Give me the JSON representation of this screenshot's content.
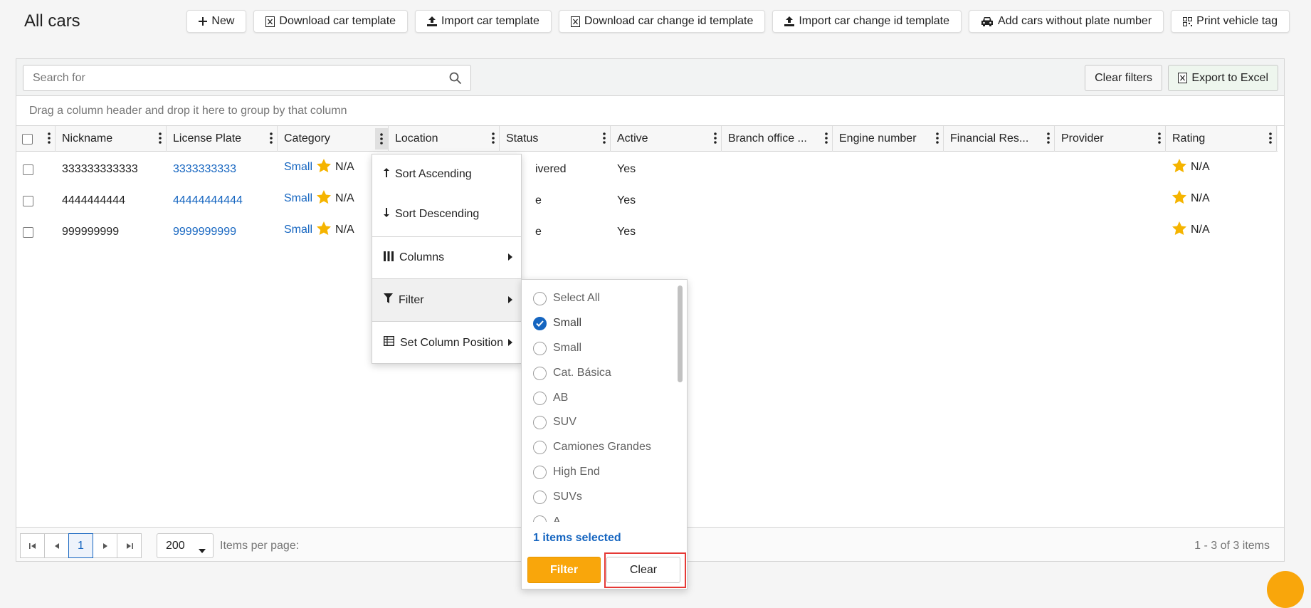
{
  "page": {
    "title": "All cars"
  },
  "toolbar": {
    "new": "New",
    "download_template": "Download car template",
    "import_template": "Import car template",
    "download_change_id": "Download car change id template",
    "import_change_id": "Import car change id template",
    "add_without_plate": "Add cars without plate number",
    "print_tag": "Print vehicle tag"
  },
  "grid_toolbar": {
    "search_placeholder": "Search for",
    "clear_filters": "Clear filters",
    "export_excel": "Export to Excel"
  },
  "group_hint": "Drag a column header and drop it here to group by that column",
  "columns": {
    "nickname": "Nickname",
    "license_plate": "License Plate",
    "category": "Category",
    "location": "Location",
    "status": "Status",
    "active": "Active",
    "branch_office": "Branch office ...",
    "engine_number": "Engine number",
    "financial": "Financial Res...",
    "provider": "Provider",
    "rating": "Rating"
  },
  "rows": [
    {
      "nickname": "333333333333",
      "plate": "3333333333",
      "category": "Small",
      "category_rating": "N/A",
      "status": "ivered",
      "active": "Yes",
      "rating": "N/A"
    },
    {
      "nickname": "4444444444",
      "plate": "44444444444",
      "category": "Small",
      "category_rating": "N/A",
      "status": "e",
      "active": "Yes",
      "rating": "N/A"
    },
    {
      "nickname": "999999999",
      "plate": "9999999999",
      "category": "Small",
      "category_rating": "N/A",
      "status": "e",
      "active": "Yes",
      "rating": "N/A"
    }
  ],
  "column_menu": {
    "sort_asc": "Sort Ascending",
    "sort_desc": "Sort Descending",
    "columns": "Columns",
    "filter": "Filter",
    "set_position": "Set Column Position"
  },
  "filter_popup": {
    "options": [
      {
        "label": "Select All",
        "checked": false
      },
      {
        "label": "Small",
        "checked": true
      },
      {
        "label": "Small",
        "checked": false
      },
      {
        "label": "Cat. Básica",
        "checked": false
      },
      {
        "label": "AB",
        "checked": false
      },
      {
        "label": "SUV",
        "checked": false
      },
      {
        "label": "Camiones Grandes",
        "checked": false
      },
      {
        "label": "High End",
        "checked": false
      },
      {
        "label": "SUVs",
        "checked": false
      },
      {
        "label": "A",
        "checked": false
      }
    ],
    "selected_count": "1 items selected",
    "filter_button": "Filter",
    "clear_button": "Clear"
  },
  "pager": {
    "current_page": "1",
    "page_size": "200",
    "items_per_page_label": "Items per page:",
    "range": "1 - 3 of 3 items"
  },
  "colors": {
    "accent_orange": "#f9a60b",
    "link_blue": "#1565c0",
    "star_yellow": "#f5b400",
    "highlight_red": "#e53935"
  },
  "icons": {
    "search": "search-icon",
    "kebab": "kebab-icon",
    "star": "star-icon",
    "excel": "excel-icon"
  }
}
